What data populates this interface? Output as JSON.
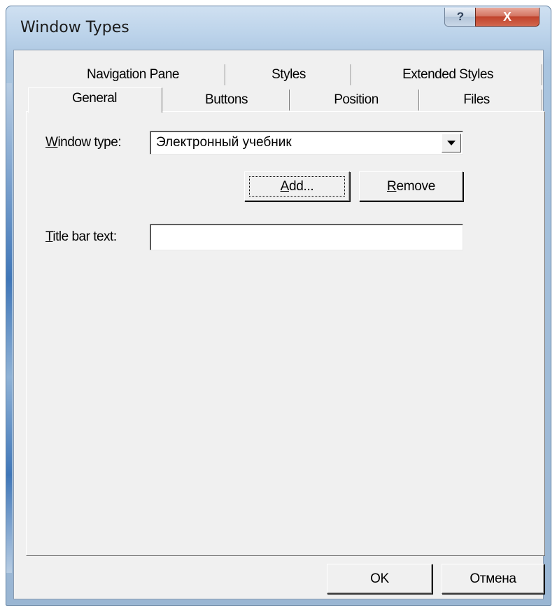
{
  "window": {
    "title": "Window Types",
    "help_symbol": "?",
    "close_symbol": "X"
  },
  "tabs": {
    "back_row": [
      "Navigation Pane",
      "Styles",
      "Extended Styles"
    ],
    "front_row": [
      "General",
      "Buttons",
      "Position",
      "Files"
    ],
    "selected": "General"
  },
  "general": {
    "window_type_label_mnemonic": "W",
    "window_type_label_rest": "indow type:",
    "window_type_value": "Электронный учебник",
    "add_button_mnemonic": "A",
    "add_button_rest": "dd...",
    "remove_button_mnemonic": "R",
    "remove_button_rest": "emove",
    "title_bar_label_mnemonic": "T",
    "title_bar_label_rest": "itle bar text:",
    "title_bar_value": ""
  },
  "footer": {
    "ok_label": "OK",
    "cancel_label": "Отмена"
  },
  "colors": {
    "dialog_bg": "#f0f0f0",
    "frame_blue": "#bcd3ea",
    "close_red": "#c0432c"
  }
}
